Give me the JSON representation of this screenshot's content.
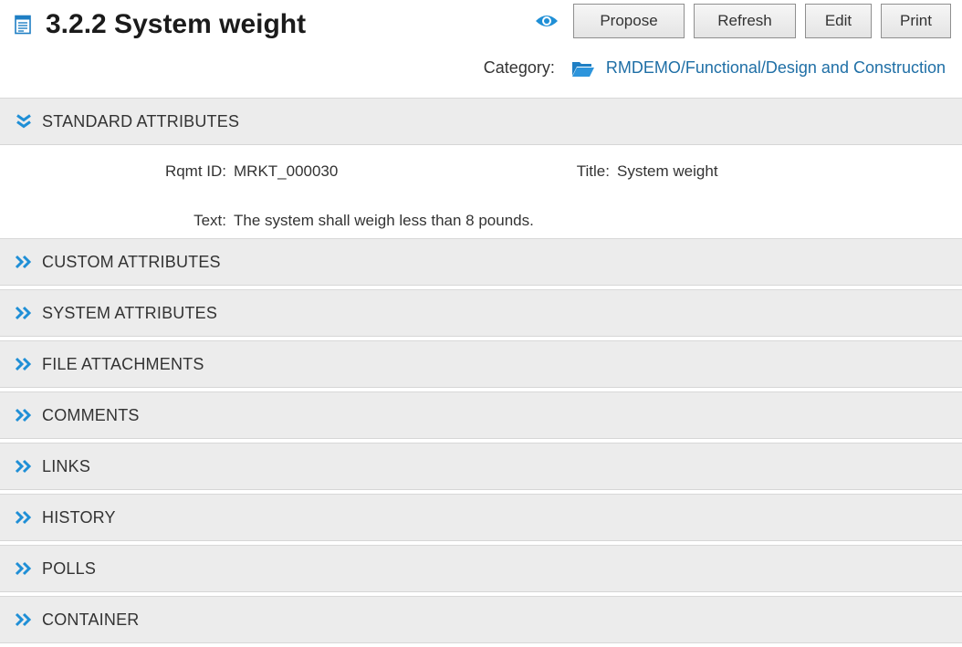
{
  "header": {
    "title": "3.2.2 System weight",
    "doc_icon": "document-icon",
    "view_icon": "eye-icon",
    "buttons": {
      "propose": "Propose",
      "refresh": "Refresh",
      "edit": "Edit",
      "print": "Print"
    }
  },
  "category": {
    "label": "Category:",
    "icon": "folder-open-icon",
    "path": "RMDEMO/Functional/Design and Construction"
  },
  "colors": {
    "accent": "#1f8fd6",
    "link": "#1f6fa6",
    "section_bg": "#ececec"
  },
  "standard_attributes": {
    "label": "STANDARD ATTRIBUTES",
    "expanded": true,
    "rqmt_id_label": "Rqmt ID:",
    "rqmt_id_value": "MRKT_000030",
    "title_label": "Title:",
    "title_value": "System weight",
    "text_label": "Text:",
    "text_value": "The system shall weigh less than 8 pounds."
  },
  "sections": [
    {
      "label": "CUSTOM ATTRIBUTES",
      "expanded": false
    },
    {
      "label": "SYSTEM ATTRIBUTES",
      "expanded": false
    },
    {
      "label": "FILE ATTACHMENTS",
      "expanded": false
    },
    {
      "label": "COMMENTS",
      "expanded": false
    },
    {
      "label": "LINKS",
      "expanded": false
    },
    {
      "label": "HISTORY",
      "expanded": false
    },
    {
      "label": "POLLS",
      "expanded": false
    },
    {
      "label": "CONTAINER",
      "expanded": false
    }
  ]
}
